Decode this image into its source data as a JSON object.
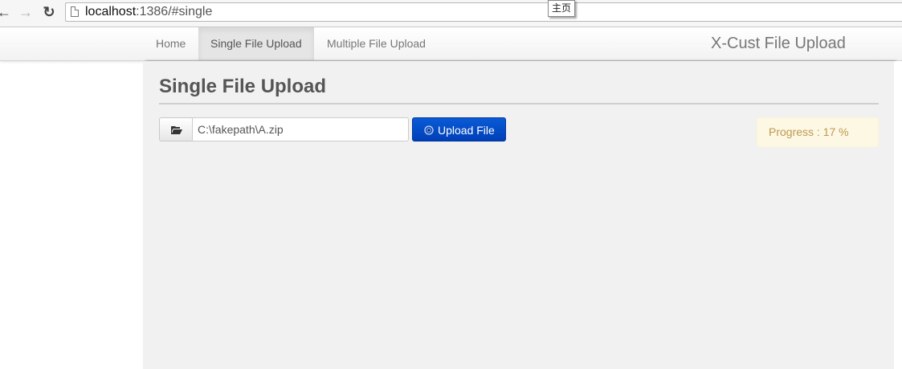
{
  "browser": {
    "url_host": "localhost",
    "url_rest": ":1386/#single",
    "tooltip": "主页"
  },
  "navbar": {
    "items": [
      {
        "label": "Home"
      },
      {
        "label": "Single File Upload",
        "active": true
      },
      {
        "label": "Multiple File Upload"
      }
    ],
    "brand": "X-Cust File Upload"
  },
  "main": {
    "title": "Single File Upload",
    "file_input_value": "C:\\fakepath\\A.zip",
    "upload_button_label": "Upload File",
    "progress_text": "Progress : 17 %"
  },
  "colors": {
    "upload_button": "#0047c2",
    "progress_bg": "#fcf8e3",
    "progress_text": "#c09853",
    "content_bg": "#f1f1f1"
  },
  "icons": {
    "back": "arrow-left-icon",
    "forward": "arrow-right-icon",
    "reload": "reload-icon",
    "page": "page-icon",
    "folder": "folder-open-icon",
    "upload": "upload-circle-icon"
  }
}
